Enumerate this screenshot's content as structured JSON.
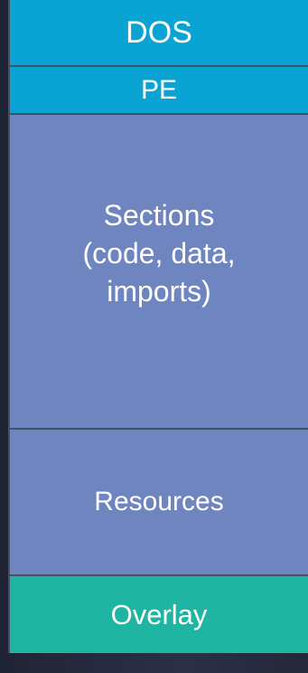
{
  "diagram": {
    "blocks": [
      {
        "label": "DOS"
      },
      {
        "label": "PE"
      },
      {
        "label": "Sections\n(code, data,\nimports)"
      },
      {
        "label": "Resources"
      },
      {
        "label": "Overlay"
      }
    ]
  },
  "colors": {
    "header": "#09a4d3",
    "body": "#6f85c0",
    "overlay": "#20b5a2",
    "background": "#23283a"
  }
}
